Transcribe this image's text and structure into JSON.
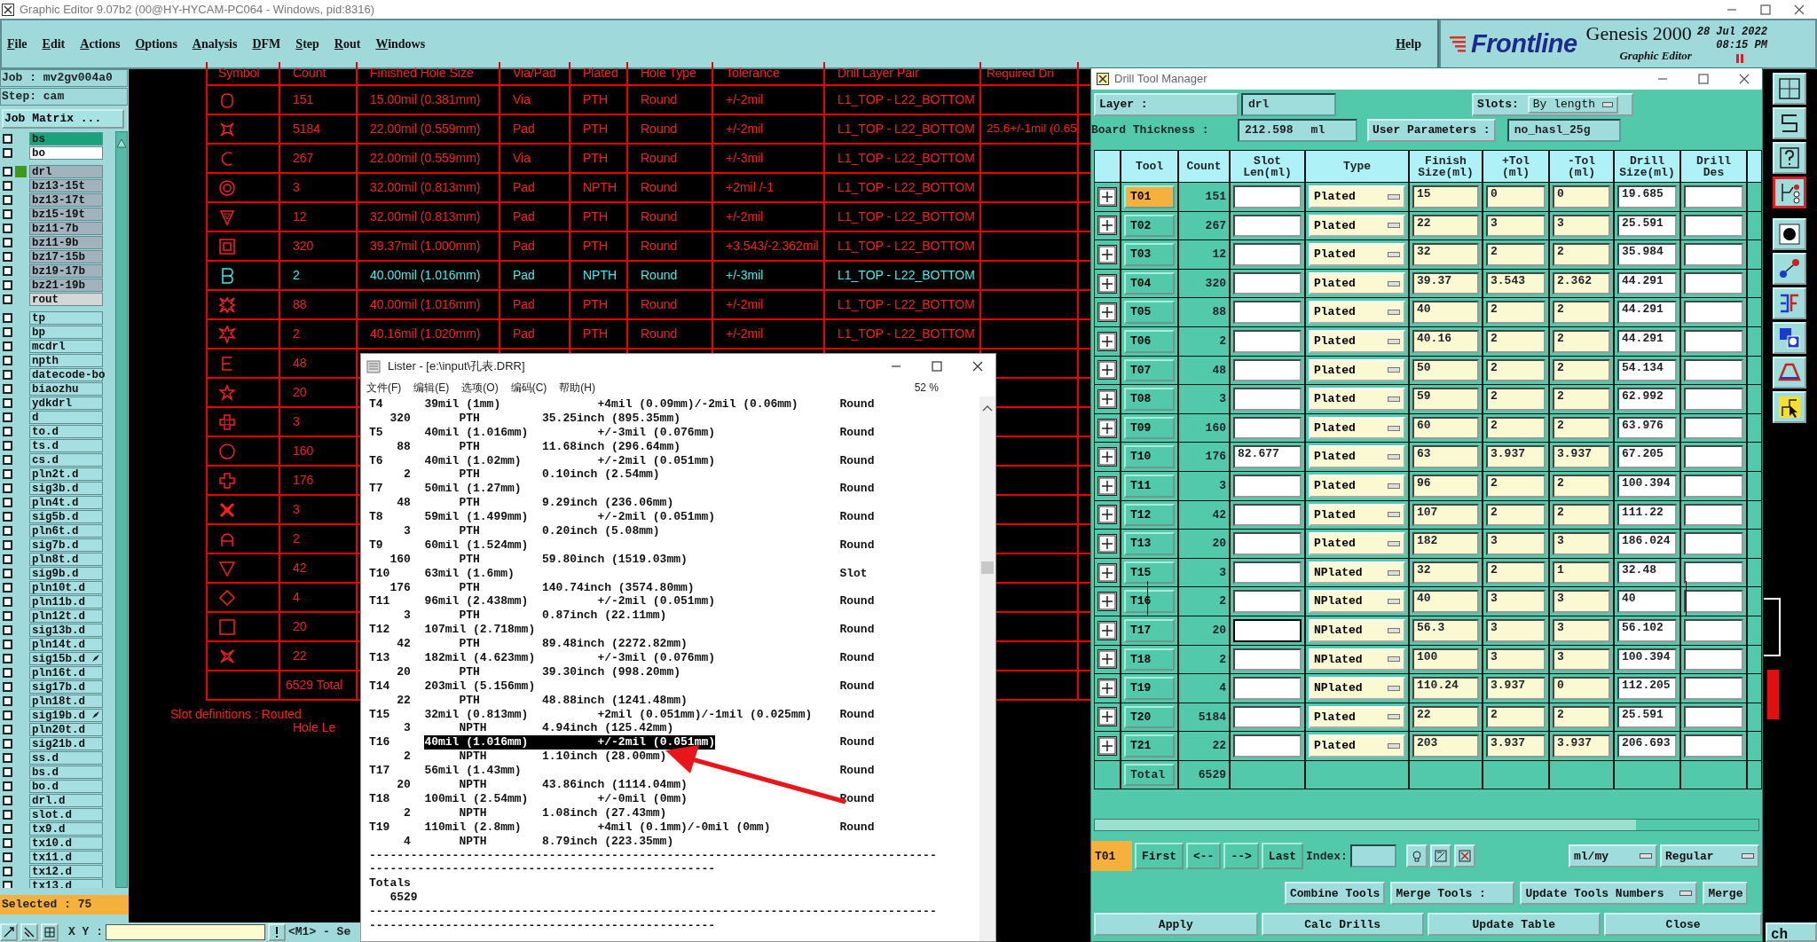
{
  "window": {
    "title": "Graphic Editor 9.07b2 (00@HY-HYCAM-PC064 - Windows, pid:8316)"
  },
  "menu": [
    "File",
    "Edit",
    "Actions",
    "Options",
    "Analysis",
    "DFM",
    "Step",
    "Rout",
    "Windows"
  ],
  "help": "Help",
  "brand": {
    "logo": "Frontline",
    "product": "Genesis 2000",
    "subtitle": "Graphic Editor",
    "date": "28 Jul 2022",
    "time": "08:15 PM"
  },
  "job_panel": {
    "job": "Job : mv2gv004a0",
    "step": "Step: cam",
    "matrix_button": "Job Matrix ...",
    "selected_count": "Selected : 75",
    "groups": [
      [
        {
          "name": "bs",
          "color": "#1aa37a",
          "checked": false,
          "active": false,
          "marked": false
        },
        {
          "name": "bo",
          "color": "#ffffff",
          "checked": false,
          "active": false,
          "marked": false
        }
      ],
      [
        {
          "name": "drl",
          "color": "#a2b3bd",
          "checked": false,
          "active": true,
          "marked": false
        },
        {
          "name": "bz13-15t",
          "color": "#a2b3bd",
          "checked": false,
          "active": false,
          "marked": false
        },
        {
          "name": "bz13-17t",
          "color": "#a2b3bd",
          "checked": false,
          "active": false,
          "marked": false
        },
        {
          "name": "bz15-19t",
          "color": "#a2b3bd",
          "checked": false,
          "active": false,
          "marked": false
        },
        {
          "name": "bz11-7b",
          "color": "#a2b3bd",
          "checked": false,
          "active": false,
          "marked": false
        },
        {
          "name": "bz11-9b",
          "color": "#a2b3bd",
          "checked": false,
          "active": false,
          "marked": false
        },
        {
          "name": "bz17-15b",
          "color": "#a2b3bd",
          "checked": false,
          "active": false,
          "marked": false
        },
        {
          "name": "bz19-17b",
          "color": "#a2b3bd",
          "checked": false,
          "active": false,
          "marked": false
        },
        {
          "name": "bz21-19b",
          "color": "#a2b3bd",
          "checked": false,
          "active": false,
          "marked": false
        },
        {
          "name": "rout",
          "color": "#d6d6d6",
          "checked": false,
          "active": false,
          "marked": false
        }
      ],
      [
        {
          "name": "tp",
          "color": "#a6dfe2",
          "checked": false,
          "active": false,
          "marked": false
        },
        {
          "name": "bp",
          "color": "#a6dfe2",
          "checked": false,
          "active": false,
          "marked": false
        },
        {
          "name": "mcdrl",
          "color": "#a6dfe2",
          "checked": false,
          "active": false,
          "marked": false
        },
        {
          "name": "npth",
          "color": "#a6dfe2",
          "checked": false,
          "active": false,
          "marked": false
        },
        {
          "name": "datecode-bo",
          "color": "#a6dfe2",
          "checked": false,
          "active": false,
          "marked": false
        },
        {
          "name": "biaozhu",
          "color": "#a6dfe2",
          "checked": false,
          "active": false,
          "marked": false
        },
        {
          "name": "ydkdrl",
          "color": "#a6dfe2",
          "checked": false,
          "active": false,
          "marked": false
        },
        {
          "name": "d",
          "color": "#a6dfe2",
          "checked": false,
          "active": false,
          "marked": false
        },
        {
          "name": "to.d",
          "color": "#a6dfe2",
          "checked": false,
          "active": false,
          "marked": false
        },
        {
          "name": "ts.d",
          "color": "#a6dfe2",
          "checked": false,
          "active": false,
          "marked": false
        },
        {
          "name": "cs.d",
          "color": "#a6dfe2",
          "checked": false,
          "active": false,
          "marked": false
        },
        {
          "name": "pln2t.d",
          "color": "#a6dfe2",
          "checked": false,
          "active": false,
          "marked": false
        },
        {
          "name": "sig3b.d",
          "color": "#a6dfe2",
          "checked": false,
          "active": false,
          "marked": false
        },
        {
          "name": "pln4t.d",
          "color": "#a6dfe2",
          "checked": false,
          "active": false,
          "marked": false
        },
        {
          "name": "sig5b.d",
          "color": "#a6dfe2",
          "checked": false,
          "active": false,
          "marked": false
        },
        {
          "name": "pln6t.d",
          "color": "#a6dfe2",
          "checked": false,
          "active": false,
          "marked": false
        },
        {
          "name": "sig7b.d",
          "color": "#a6dfe2",
          "checked": false,
          "active": false,
          "marked": false
        },
        {
          "name": "pln8t.d",
          "color": "#a6dfe2",
          "checked": false,
          "active": false,
          "marked": false
        },
        {
          "name": "sig9b.d",
          "color": "#a6dfe2",
          "checked": false,
          "active": false,
          "marked": false
        },
        {
          "name": "pln10t.d",
          "color": "#a6dfe2",
          "checked": false,
          "active": false,
          "marked": false
        },
        {
          "name": "pln11b.d",
          "color": "#a6dfe2",
          "checked": false,
          "active": false,
          "marked": false
        },
        {
          "name": "pln12t.d",
          "color": "#a6dfe2",
          "checked": false,
          "active": false,
          "marked": false
        },
        {
          "name": "sig13b.d",
          "color": "#a6dfe2",
          "checked": false,
          "active": false,
          "marked": false
        },
        {
          "name": "pln14t.d",
          "color": "#a6dfe2",
          "checked": false,
          "active": false,
          "marked": false
        },
        {
          "name": "sig15b.d",
          "color": "#a6dfe2",
          "checked": false,
          "active": false,
          "marked": true
        },
        {
          "name": "pln16t.d",
          "color": "#a6dfe2",
          "checked": false,
          "active": false,
          "marked": false
        },
        {
          "name": "sig17b.d",
          "color": "#a6dfe2",
          "checked": false,
          "active": false,
          "marked": false
        },
        {
          "name": "pln18t.d",
          "color": "#a6dfe2",
          "checked": false,
          "active": false,
          "marked": false
        },
        {
          "name": "sig19b.d",
          "color": "#a6dfe2",
          "checked": false,
          "active": false,
          "marked": true
        },
        {
          "name": "pln20t.d",
          "color": "#a6dfe2",
          "checked": false,
          "active": false,
          "marked": false
        },
        {
          "name": "sig21b.d",
          "color": "#a6dfe2",
          "checked": false,
          "active": false,
          "marked": false
        },
        {
          "name": "ss.d",
          "color": "#a6dfe2",
          "checked": false,
          "active": false,
          "marked": false
        },
        {
          "name": "bs.d",
          "color": "#a6dfe2",
          "checked": false,
          "active": false,
          "marked": false
        },
        {
          "name": "bo.d",
          "color": "#a6dfe2",
          "checked": false,
          "active": false,
          "marked": false
        },
        {
          "name": "drl.d",
          "color": "#a6dfe2",
          "checked": false,
          "active": false,
          "marked": false
        },
        {
          "name": "slot.d",
          "color": "#a6dfe2",
          "checked": false,
          "active": false,
          "marked": false
        },
        {
          "name": "tx9.d",
          "color": "#a6dfe2",
          "checked": false,
          "active": false,
          "marked": false
        },
        {
          "name": "tx10.d",
          "color": "#a6dfe2",
          "checked": false,
          "active": false,
          "marked": false
        },
        {
          "name": "tx11.d",
          "color": "#a6dfe2",
          "checked": false,
          "active": false,
          "marked": false
        },
        {
          "name": "tx12.d",
          "color": "#a6dfe2",
          "checked": false,
          "active": false,
          "marked": false
        },
        {
          "name": "tx13.d",
          "color": "#a6dfe2",
          "checked": false,
          "active": false,
          "marked": false
        }
      ]
    ]
  },
  "status_bar": {
    "xy_label": "X Y :",
    "mode": "<M1> - Se",
    "corner": "ch"
  },
  "drill_report": {
    "columns": [
      "Symbol",
      "Count",
      "Finished Hole Size",
      "Via/Pad",
      "Plated",
      "Hole Type",
      "Tolerance",
      "Drill Layer Pair",
      "Required Dri"
    ],
    "rows": [
      {
        "count": "151",
        "size": "15.00mil (0.381mm)",
        "via_pad": "Via",
        "plated": "PTH",
        "hole_type": "Round",
        "tolerance": "+/-2mil",
        "layer_pair": "L1_TOP - L22_BOTTOM",
        "highlighted": false
      },
      {
        "count": "5184",
        "size": "22.00mil (0.559mm)",
        "via_pad": "Pad",
        "plated": "PTH",
        "hole_type": "Round",
        "tolerance": "+/-2mil",
        "layer_pair": "L1_TOP - L22_BOTTOM",
        "required": "25.6+/-1mil (0.65",
        "highlighted": false
      },
      {
        "count": "267",
        "size": "22.00mil (0.559mm)",
        "via_pad": "Via",
        "plated": "PTH",
        "hole_type": "Round",
        "tolerance": "+/-3mil",
        "layer_pair": "L1_TOP - L22_BOTTOM",
        "highlighted": false
      },
      {
        "count": "3",
        "size": "32.00mil (0.813mm)",
        "via_pad": "Pad",
        "plated": "NPTH",
        "hole_type": "Round",
        "tolerance": "+2mil /-1",
        "layer_pair": "L1_TOP - L22_BOTTOM",
        "highlighted": false
      },
      {
        "count": "12",
        "size": "32.00mil (0.813mm)",
        "via_pad": "Pad",
        "plated": "PTH",
        "hole_type": "Round",
        "tolerance": "+/-2mil",
        "layer_pair": "L1_TOP - L22_BOTTOM",
        "highlighted": false
      },
      {
        "count": "320",
        "size": "39.37mil (1.000mm)",
        "via_pad": "Pad",
        "plated": "PTH",
        "hole_type": "Round",
        "tolerance": "+3.543/-2.362mil",
        "layer_pair": "L1_TOP - L22_BOTTOM",
        "highlighted": false
      },
      {
        "count": "2",
        "size": "40.00mil (1.016mm)",
        "via_pad": "Pad",
        "plated": "NPTH",
        "hole_type": "Round",
        "tolerance": "+/-3mil",
        "layer_pair": "L1_TOP - L22_BOTTOM",
        "highlighted": true
      },
      {
        "count": "88",
        "size": "40.00mil (1.016mm)",
        "via_pad": "Pad",
        "plated": "PTH",
        "hole_type": "Round",
        "tolerance": "+/-2mil",
        "layer_pair": "L1_TOP - L22_BOTTOM",
        "highlighted": false
      },
      {
        "count": "2",
        "size": "40.16mil (1.020mm)",
        "via_pad": "Pad",
        "plated": "PTH",
        "hole_type": "Round",
        "tolerance": "+/-2mil",
        "layer_pair": "L1_TOP - L22_BOTTOM",
        "highlighted": false
      },
      {
        "count": "48",
        "highlighted": false
      },
      {
        "count": "20",
        "highlighted": false
      },
      {
        "count": "3",
        "highlighted": false
      },
      {
        "count": "160",
        "highlighted": false
      },
      {
        "count": "176",
        "highlighted": false
      },
      {
        "count": "3",
        "highlighted": false
      },
      {
        "count": "2",
        "highlighted": false
      },
      {
        "count": "42",
        "highlighted": false
      },
      {
        "count": "4",
        "highlighted": false
      },
      {
        "count": "20",
        "highlighted": false
      },
      {
        "count": "22",
        "highlighted": false
      }
    ],
    "total": "6529 Total",
    "notes": [
      "Slot definitions : Routed",
      "Hole Le"
    ]
  },
  "lister": {
    "title": "Lister - [e:\\input\\孔表.DRR]",
    "menu": [
      "文件(F)",
      "编辑(E)",
      "选项(O)",
      "编码(C)",
      "帮助(H)"
    ],
    "zoom": "52 %",
    "entries": [
      {
        "tool": "T4",
        "size": "39mil (1mm)",
        "tolerance": "+4mil (0.09mm)/-2mil (0.06mm)",
        "hole_type": "Round",
        "count": "320",
        "plated": "PTH",
        "length": "35.25inch (895.35mm)",
        "selected": false
      },
      {
        "tool": "T5",
        "size": "40mil (1.016mm)",
        "tolerance": "+/-3mil (0.076mm)",
        "hole_type": "Round",
        "count": "88",
        "plated": "PTH",
        "length": "11.68inch (296.64mm)",
        "selected": false
      },
      {
        "tool": "T6",
        "size": "40mil (1.02mm)",
        "tolerance": "+/-2mil (0.051mm)",
        "hole_type": "Round",
        "count": "2",
        "plated": "PTH",
        "length": "0.10inch (2.54mm)",
        "selected": false
      },
      {
        "tool": "T7",
        "size": "50mil (1.27mm)",
        "hole_type": "Round",
        "count": "48",
        "plated": "PTH",
        "length": "9.29inch (236.06mm)",
        "selected": false
      },
      {
        "tool": "T8",
        "size": "59mil (1.499mm)",
        "tolerance": "+/-2mil (0.051mm)",
        "hole_type": "Round",
        "count": "3",
        "plated": "PTH",
        "length": "0.20inch (5.08mm)",
        "selected": false
      },
      {
        "tool": "T9",
        "size": "60mil (1.524mm)",
        "hole_type": "Round",
        "count": "160",
        "plated": "PTH",
        "length": "59.80inch (1519.03mm)",
        "selected": false
      },
      {
        "tool": "T10",
        "size": "63mil (1.6mm)",
        "hole_type": "Slot",
        "count": "176",
        "plated": "PTH",
        "length": "140.74inch (3574.80mm)",
        "selected": false
      },
      {
        "tool": "T11",
        "size": "96mil (2.438mm)",
        "tolerance": "+/-2mil (0.051mm)",
        "hole_type": "Round",
        "count": "3",
        "plated": "PTH",
        "length": "0.87inch (22.11mm)",
        "selected": false
      },
      {
        "tool": "T12",
        "size": "107mil (2.718mm)",
        "hole_type": "Round",
        "count": "42",
        "plated": "PTH",
        "length": "89.48inch (2272.82mm)",
        "selected": false
      },
      {
        "tool": "T13",
        "size": "182mil (4.623mm)",
        "tolerance": "+/-3mil (0.076mm)",
        "hole_type": "Round",
        "count": "20",
        "plated": "PTH",
        "length": "39.30inch (998.20mm)",
        "selected": false
      },
      {
        "tool": "T14",
        "size": "203mil (5.156mm)",
        "hole_type": "Round",
        "count": "22",
        "plated": "PTH",
        "length": "48.88inch (1241.48mm)",
        "selected": false
      },
      {
        "tool": "T15",
        "size": "32mil (0.813mm)",
        "tolerance": "+2mil (0.051mm)/-1mil (0.025mm)",
        "hole_type": "Round",
        "count": "3",
        "plated": "NPTH",
        "length": "4.94inch (125.42mm)",
        "selected": false
      },
      {
        "tool": "T16",
        "size": "40mil (1.016mm)",
        "tolerance": "+/-2mil (0.051mm)",
        "hole_type": "Round",
        "count": "2",
        "plated": "NPTH",
        "length": "1.10inch (28.00mm)",
        "selected": true
      },
      {
        "tool": "T17",
        "size": "56mil (1.43mm)",
        "hole_type": "Round",
        "count": "20",
        "plated": "NPTH",
        "length": "43.86inch (1114.04mm)",
        "selected": false
      },
      {
        "tool": "T18",
        "size": "100mil (2.54mm)",
        "tolerance": "+/-0mil (0mm)",
        "hole_type": "Round",
        "count": "2",
        "plated": "NPTH",
        "length": "1.08inch (27.43mm)",
        "selected": false
      },
      {
        "tool": "T19",
        "size": "110mil (2.8mm)",
        "tolerance": "+4mil (0.1mm)/-0mil (0mm)",
        "hole_type": "Round",
        "count": "4",
        "plated": "NPTH",
        "length": "8.79inch (223.35mm)",
        "selected": false
      }
    ],
    "footer": [
      {
        "kind": "rule",
        "text": "----------------------------------------------------------------------------------"
      },
      {
        "kind": "rule",
        "text": "--------------------------------------------------"
      },
      {
        "kind": "label",
        "text": "Totals"
      },
      {
        "kind": "value",
        "text": "6529"
      },
      {
        "kind": "rule",
        "text": "----------------------------------------------------------------------------------"
      },
      {
        "kind": "rule",
        "text": "--------------------------------------------------"
      }
    ]
  },
  "drill_tool_manager": {
    "title": "Drill Tool Manager",
    "layer_label": "Layer :",
    "layer": "drl",
    "slots_label": "Slots:",
    "slots": "By length",
    "thickness_label": "Board Thickness :",
    "thickness": "212.598",
    "thickness_unit": "ml",
    "user_params_label": "User Parameters :",
    "user_params": "no_hasl_25g",
    "columns": [
      "Tool",
      "Count",
      "Slot Len(ml)",
      "Type",
      "Finish Size(ml)",
      "+Tol (ml)",
      "-Tol (ml)",
      "Drill Size(ml)",
      "Drill Des"
    ],
    "rows": [
      {
        "tool": "T01",
        "count": "151",
        "type": "Plated",
        "finish": "15",
        "plus_tol": "0",
        "minus_tol": "0",
        "drill": "19.685",
        "selected": true,
        "outlined": false,
        "focused": false
      },
      {
        "tool": "T02",
        "count": "267",
        "type": "Plated",
        "finish": "22",
        "plus_tol": "3",
        "minus_tol": "3",
        "drill": "25.591",
        "selected": false,
        "outlined": false,
        "focused": false
      },
      {
        "tool": "T03",
        "count": "12",
        "type": "Plated",
        "finish": "32",
        "plus_tol": "2",
        "minus_tol": "2",
        "drill": "35.984",
        "selected": false,
        "outlined": false,
        "focused": false
      },
      {
        "tool": "T04",
        "count": "320",
        "type": "Plated",
        "finish": "39.37",
        "plus_tol": "3.543",
        "minus_tol": "2.362",
        "drill": "44.291",
        "selected": false,
        "outlined": false,
        "focused": false
      },
      {
        "tool": "T05",
        "count": "88",
        "type": "Plated",
        "finish": "40",
        "plus_tol": "2",
        "minus_tol": "2",
        "drill": "44.291",
        "selected": false,
        "outlined": false,
        "focused": false
      },
      {
        "tool": "T06",
        "count": "2",
        "type": "Plated",
        "finish": "40.16",
        "plus_tol": "2",
        "minus_tol": "2",
        "drill": "44.291",
        "selected": false,
        "outlined": false,
        "focused": false
      },
      {
        "tool": "T07",
        "count": "48",
        "type": "Plated",
        "finish": "50",
        "plus_tol": "2",
        "minus_tol": "2",
        "drill": "54.134",
        "selected": false,
        "outlined": false,
        "focused": false
      },
      {
        "tool": "T08",
        "count": "3",
        "type": "Plated",
        "finish": "59",
        "plus_tol": "2",
        "minus_tol": "2",
        "drill": "62.992",
        "selected": false,
        "outlined": false,
        "focused": false
      },
      {
        "tool": "T09",
        "count": "160",
        "type": "Plated",
        "finish": "60",
        "plus_tol": "2",
        "minus_tol": "2",
        "drill": "63.976",
        "selected": false,
        "outlined": false,
        "focused": false
      },
      {
        "tool": "T10",
        "count": "176",
        "slot_len": "82.677",
        "type": "Plated",
        "finish": "63",
        "plus_tol": "3.937",
        "minus_tol": "3.937",
        "drill": "67.205",
        "selected": false,
        "outlined": false,
        "focused": false
      },
      {
        "tool": "T11",
        "count": "3",
        "type": "Plated",
        "finish": "96",
        "plus_tol": "2",
        "minus_tol": "2",
        "drill": "100.394",
        "selected": false,
        "outlined": false,
        "focused": false
      },
      {
        "tool": "T12",
        "count": "42",
        "type": "Plated",
        "finish": "107",
        "plus_tol": "2",
        "minus_tol": "2",
        "drill": "111.22",
        "selected": false,
        "outlined": false,
        "focused": false
      },
      {
        "tool": "T13",
        "count": "20",
        "type": "Plated",
        "finish": "182",
        "plus_tol": "3",
        "minus_tol": "3",
        "drill": "186.024",
        "selected": false,
        "outlined": false,
        "focused": false
      },
      {
        "tool": "T15",
        "count": "3",
        "type": "NPlated",
        "finish": "32",
        "plus_tol": "2",
        "minus_tol": "1",
        "drill": "32.48",
        "selected": false,
        "outlined": false,
        "focused": false
      },
      {
        "tool": "T16",
        "count": "2",
        "type": "NPlated",
        "finish": "40",
        "plus_tol": "3",
        "minus_tol": "3",
        "drill": "40",
        "selected": false,
        "outlined": true,
        "focused": false
      },
      {
        "tool": "T17",
        "count": "20",
        "type": "NPlated",
        "finish": "56.3",
        "plus_tol": "3",
        "minus_tol": "3",
        "drill": "56.102",
        "selected": false,
        "outlined": false,
        "focused": true
      },
      {
        "tool": "T18",
        "count": "2",
        "type": "NPlated",
        "finish": "100",
        "plus_tol": "3",
        "minus_tol": "3",
        "drill": "100.394",
        "selected": false,
        "outlined": false,
        "focused": false
      },
      {
        "tool": "T19",
        "count": "4",
        "type": "NPlated",
        "finish": "110.24",
        "plus_tol": "3.937",
        "minus_tol": "0",
        "drill": "112.205",
        "selected": false,
        "outlined": false,
        "focused": false
      },
      {
        "tool": "T20",
        "count": "5184",
        "type": "Plated",
        "finish": "22",
        "plus_tol": "2",
        "minus_tol": "2",
        "drill": "25.591",
        "selected": false,
        "outlined": false,
        "focused": false
      },
      {
        "tool": "T21",
        "count": "22",
        "type": "Plated",
        "finish": "203",
        "plus_tol": "3.937",
        "minus_tol": "3.937",
        "drill": "206.693",
        "selected": false,
        "outlined": false,
        "focused": false
      }
    ],
    "total_label": "Total",
    "total": "6529",
    "current_tool": "T01",
    "nav": [
      "First",
      "<--",
      "-->",
      "Last"
    ],
    "index_label": "Index:",
    "units": "ml/my",
    "mode": "Regular",
    "combine": "Combine Tools",
    "merge_label": "Merge Tools :",
    "update_numbers": "Update Tools Numbers",
    "merge": "Merge",
    "bottom_buttons": [
      "Apply",
      "Calc Drills",
      "Update Table",
      "Close"
    ]
  },
  "toolbar": [
    {
      "selected": false
    },
    {
      "selected": false
    },
    {
      "selected": false
    },
    {
      "selected": true
    },
    {
      "selected": false
    },
    {
      "selected": false
    },
    {
      "selected": false
    },
    {
      "selected": false
    },
    {
      "selected": false
    },
    {
      "selected": false
    }
  ]
}
